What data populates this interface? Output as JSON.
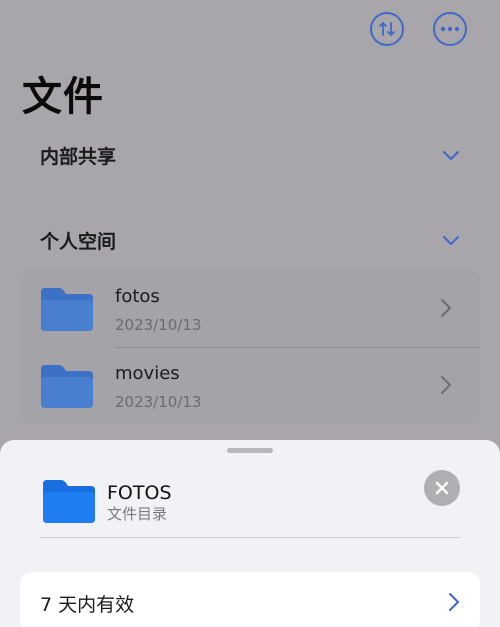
{
  "colors": {
    "accent": "#3f69c8",
    "folder_blue": "#3d71c5",
    "folder_blue_bright": "#1f7ef2",
    "dimmed_background": "#a8a6ab",
    "sheet_background": "#f2f2f6"
  },
  "header": {
    "sort_icon": "arrow-up-down-icon",
    "more_icon": "ellipsis-circle-icon"
  },
  "page": {
    "title": "文件"
  },
  "sections": {
    "shared": {
      "label": "内部共享",
      "icon": "chevron-down-icon"
    },
    "personal": {
      "label": "个人空间",
      "icon": "chevron-down-icon"
    }
  },
  "files": [
    {
      "name": "fotos",
      "date": "2023/10/13",
      "icon": "folder-icon"
    },
    {
      "name": "movies",
      "date": "2023/10/13",
      "icon": "folder-icon"
    }
  ],
  "sheet": {
    "title": "FOTOS",
    "subtitle": "文件目录",
    "close_icon": "close-icon",
    "option_label": "7 天内有效",
    "option_icon": "chevron-right-icon"
  }
}
